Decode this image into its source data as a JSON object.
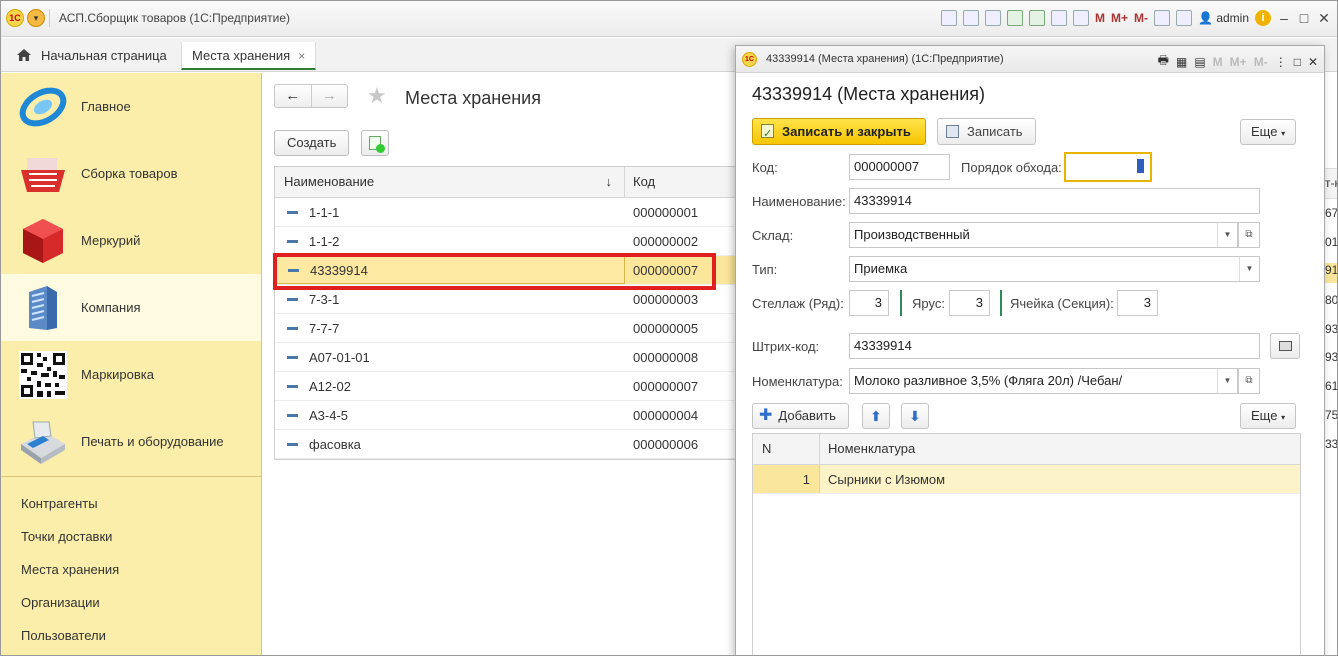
{
  "window": {
    "title": "АСП.Сборщик товаров (1С:Предприятие)",
    "user": "admin",
    "m_labels": [
      "M",
      "M+",
      "M-"
    ]
  },
  "tabs": {
    "home": "Начальная страница",
    "active": "Места хранения",
    "close": "×"
  },
  "sidebar": {
    "sections": [
      {
        "label": "Главное",
        "icon": "main-icon"
      },
      {
        "label": "Сборка товаров",
        "icon": "basket-icon"
      },
      {
        "label": "Меркурий",
        "icon": "cube-icon"
      },
      {
        "label": "Компания",
        "icon": "building-icon"
      },
      {
        "label": "Маркировка",
        "icon": "qr-icon"
      },
      {
        "label": "Печать и оборудование",
        "icon": "terminal-icon"
      }
    ],
    "links": [
      "Контрагенты",
      "Точки доставки",
      "Места хранения",
      "Организации",
      "Пользователи"
    ]
  },
  "list": {
    "title": "Места хранения",
    "create_label": "Создать",
    "columns": {
      "name": "Наименование",
      "code": "Код",
      "sort": "↓"
    },
    "rows": [
      {
        "name": "1-1-1",
        "code": "000000001"
      },
      {
        "name": "1-1-2",
        "code": "000000002"
      },
      {
        "name": "43339914",
        "code": "000000007"
      },
      {
        "name": "7-3-1",
        "code": "000000003"
      },
      {
        "name": "7-7-7",
        "code": "000000005"
      },
      {
        "name": "А07-01-01",
        "code": "000000008"
      },
      {
        "name": "А12-02",
        "code": "000000007"
      },
      {
        "name": "А3-4-5",
        "code": "000000004"
      },
      {
        "name": "фасовка",
        "code": "000000006"
      }
    ]
  },
  "dialog": {
    "window_caption": "43339914 (Места хранения) (1С:Предприятие)",
    "heading": "43339914 (Места хранения)",
    "save_close": "Записать и закрыть",
    "save": "Записать",
    "more": "Еще",
    "fields": {
      "code_label": "Код:",
      "code_value": "000000007",
      "order_label": "Порядок обхода:",
      "order_value": "",
      "name_label": "Наименование:",
      "name_value": "43339914",
      "warehouse_label": "Склад:",
      "warehouse_value": "Производственный",
      "type_label": "Тип:",
      "type_value": "Приемка",
      "rack_label": "Стеллаж (Ряд):",
      "rack_value": "3",
      "tier_label": "Ярус:",
      "tier_value": "3",
      "cell_label": "Ячейка (Секция):",
      "cell_value": "3",
      "barcode_label": "Штрих-код:",
      "barcode_value": "43339914",
      "nomenclature_label": "Номенклатура:",
      "nomenclature_value": "Молоко разливное 3,5% (Фляга 20л) /Чебан/"
    },
    "add_label": "Добавить",
    "table": {
      "columns": {
        "n": "N",
        "nomenclature": "Номенклатура"
      },
      "rows": [
        {
          "n": "1",
          "nomenclature": "Сырники с Изюмом"
        }
      ]
    }
  },
  "right_edge": [
    "т-к",
    "67",
    "01",
    "91",
    "80",
    "93",
    "93",
    "61",
    "75",
    "33"
  ]
}
